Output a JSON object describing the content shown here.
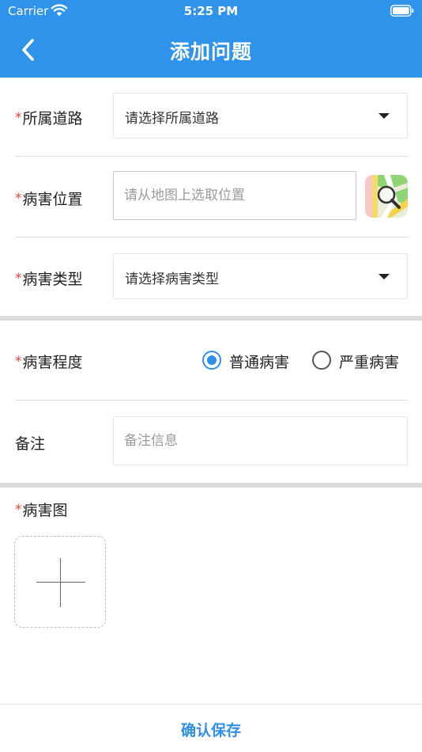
{
  "status_bar": {
    "carrier": "Carrier",
    "time": "5:25 PM"
  },
  "nav": {
    "title": "添加问题",
    "back_icon": "chevron-left-icon"
  },
  "required_mark": "*",
  "form": {
    "road": {
      "label": "所属道路",
      "placeholder": "请选择所属道路"
    },
    "location": {
      "label": "病害位置",
      "placeholder": "请从地图上选取位置",
      "map_icon": "map-search-icon"
    },
    "type": {
      "label": "病害类型",
      "placeholder": "请选择病害类型"
    },
    "severity": {
      "label": "病害程度",
      "options": [
        "普通病害",
        "严重病害"
      ],
      "selected": "普通病害"
    },
    "remark": {
      "label": "备注",
      "placeholder": "备注信息"
    },
    "image": {
      "label": "病害图",
      "add_icon": "plus-icon"
    }
  },
  "footer": {
    "confirm_label": "确认保存"
  },
  "colors": {
    "primary": "#2f93ec",
    "required": "#e34141",
    "accent": "#2f8fe8"
  }
}
